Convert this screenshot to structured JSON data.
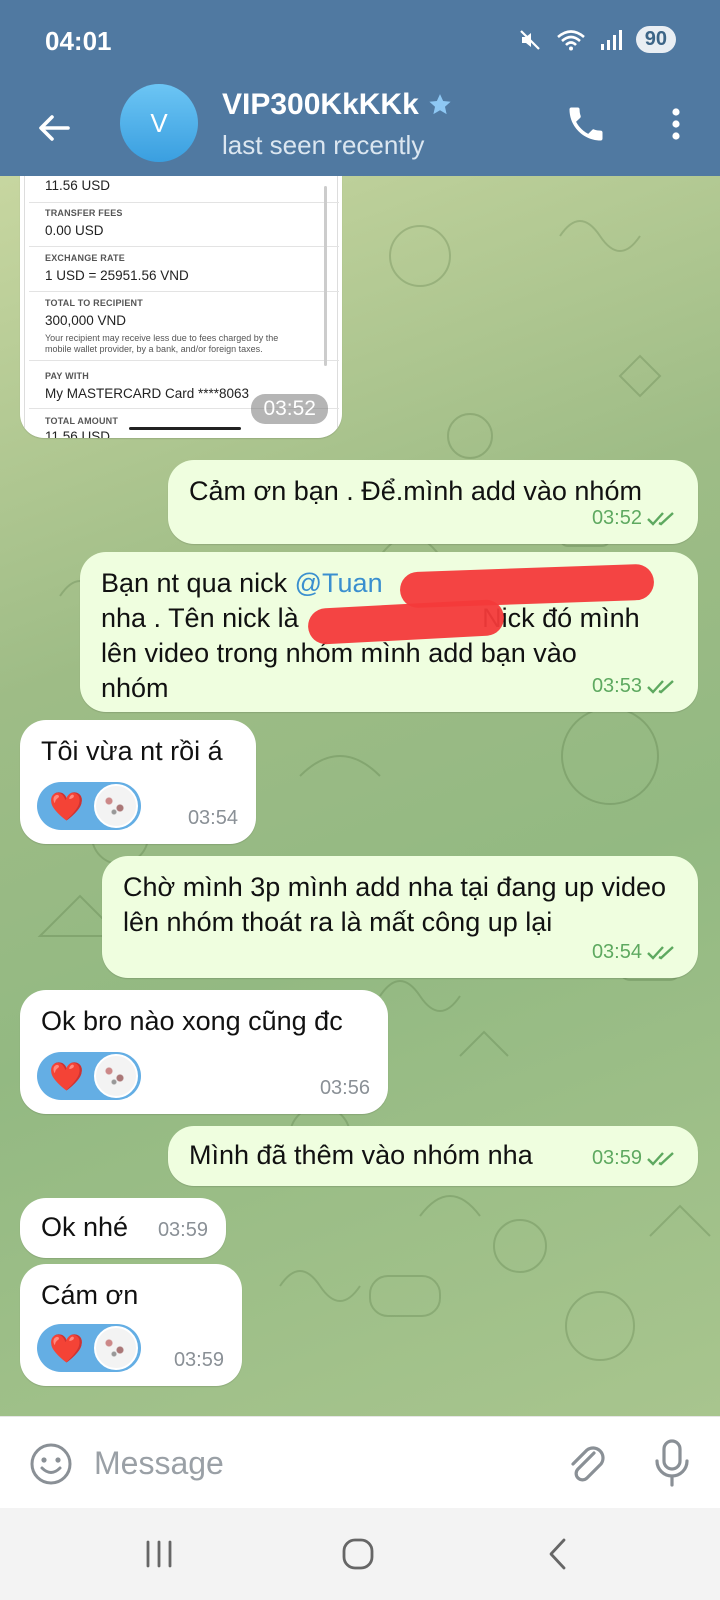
{
  "status_bar": {
    "time": "04:01",
    "battery": "90"
  },
  "header": {
    "avatar_letter": "V",
    "chat_name": "VIP300KkKKk",
    "last_seen": "last seen recently"
  },
  "receipt": {
    "top_value": "11.56 USD",
    "transfer_fees_label": "TRANSFER FEES",
    "transfer_fees": "0.00 USD",
    "exchange_rate_label": "EXCHANGE RATE",
    "exchange_rate": "1 USD = 25951.56 VND",
    "total_recipient_label": "TOTAL TO RECIPIENT",
    "total_recipient": "300,000 VND",
    "note": "Your recipient may receive less due to fees charged by the mobile wallet provider, by a bank, and/or foreign taxes.",
    "pay_with_label": "PAY WITH",
    "pay_with": "My MASTERCARD Card ****8063",
    "total_amount_label": "TOTAL AMOUNT",
    "total_amount": "11.56 USD",
    "time": "03:52"
  },
  "messages": [
    {
      "dir": "out",
      "text": "Cảm ơn bạn . Để.mình add vào nhóm",
      "time": "03:52"
    },
    {
      "dir": "out",
      "line1_prefix": "Bạn nt qua nick ",
      "mention": "@Tuan",
      "line2_prefix": "nha . Tên nick là ",
      "line2_suffix": "Nick đó mình",
      "line3": "lên video trong nhóm mình add bạn vào",
      "line4": "nhóm",
      "time": "03:53"
    },
    {
      "dir": "in",
      "text": "Tôi vừa nt rồi á",
      "time": "03:54",
      "reaction": "❤️"
    },
    {
      "dir": "out",
      "text": "Chờ mình 3p mình add nha tại đang up video lên nhóm thoát ra là mất công up lại",
      "time": "03:54"
    },
    {
      "dir": "in",
      "text": "Ok bro nào xong cũng đc",
      "time": "03:56",
      "reaction": "❤️"
    },
    {
      "dir": "out",
      "text": "Mình đã thêm vào nhóm nha",
      "time": "03:59"
    },
    {
      "dir": "in",
      "text": "Ok nhé",
      "time": "03:59"
    },
    {
      "dir": "in",
      "text": "Cám ơn",
      "time": "03:59",
      "reaction": "❤️"
    }
  ],
  "input": {
    "placeholder": "Message"
  },
  "colors": {
    "header": "#5079a1",
    "outgoing_bubble": "#effedf",
    "incoming_bubble": "#ffffff",
    "reaction": "#64aee4",
    "check_marks": "#5ea960"
  },
  "icons": [
    "back-arrow-icon",
    "verified-star-icon",
    "phone-icon",
    "more-vert-icon",
    "emoji-icon",
    "paperclip-icon",
    "microphone-icon",
    "double-check-icon",
    "heart-icon",
    "mute-icon",
    "wifi-icon",
    "signal-icon"
  ]
}
